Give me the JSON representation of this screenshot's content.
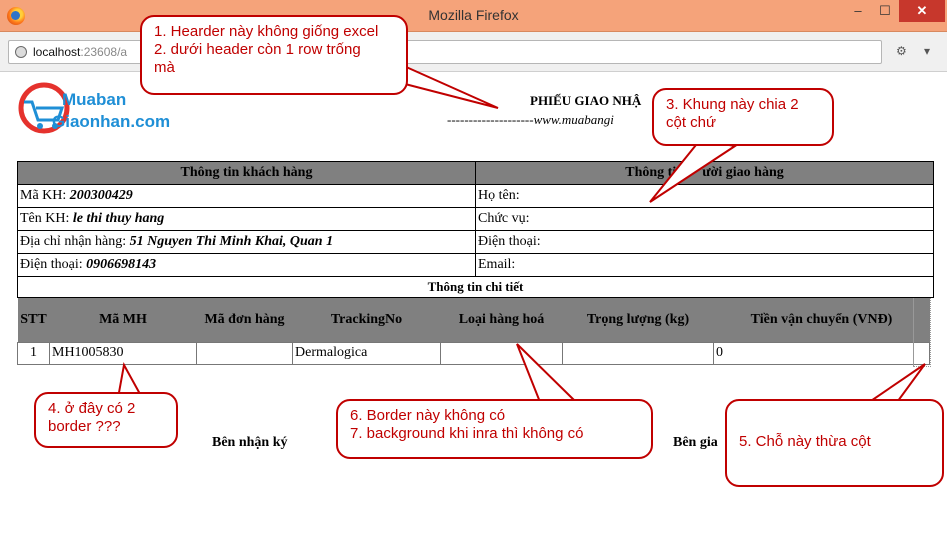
{
  "window": {
    "title": "Mozilla Firefox",
    "min_label": "–",
    "max_label": "☐",
    "close_label": "✕"
  },
  "addressbar": {
    "host": "localhost",
    "rest": ":23608/a"
  },
  "logo": {
    "line1": "Muaban",
    "line2": "Giaonhan",
    "dotcom": ".com"
  },
  "document": {
    "title": "PHIẾU GIAO NHẬ",
    "subtitle": "--------------------www.muabangi"
  },
  "customer_table": {
    "header_left": "Thông tin khách hàng",
    "header_right": "Thông ti",
    "header_right_tail": "ười giao hàng",
    "rows": [
      {
        "left_label": "Mã KH: ",
        "left_value": "200300429",
        "right_label": "Họ tên:"
      },
      {
        "left_label": "Tên KH: ",
        "left_value": "le thi thuy hang",
        "right_label": "Chức vụ:"
      },
      {
        "left_label": "Địa chỉ nhận hàng: ",
        "left_value": "51 Nguyen Thi Minh Khai, Quan 1",
        "right_label": "Điện thoại:"
      },
      {
        "left_label": "Điện thoại: ",
        "left_value": "0906698143",
        "right_label": "Email:"
      }
    ],
    "detail_caption": "Thông tin chi tiết"
  },
  "detail_table": {
    "headers": [
      "STT",
      "Mã MH",
      "Mã đơn hàng",
      "TrackingNo",
      "Loại hàng hoá",
      "Trọng lượng (kg)",
      "Tiền vận chuyển (VNĐ)"
    ],
    "rows": [
      [
        "1",
        "MH1005830",
        "",
        "Dermalogica",
        "",
        "",
        "0"
      ]
    ]
  },
  "signatures": {
    "left": "Bên nhận ký",
    "right": "Bên gia"
  },
  "callouts": {
    "c1_line1": "1. Hearder này không giống excel",
    "c1_line2": "2. dưới header còn 1 row trống",
    "c1_line3": "mà",
    "c3_line1": "3. Khung này chia 2",
    "c3_line2": "cột chứ",
    "c4_line1": "4. ở đây có 2",
    "c4_line2": "border ???",
    "c6_line1": "6. Border này không có",
    "c6_line2": "7. background khi inra thì không có",
    "c5_line1": "5. Chỗ này thừa cột"
  },
  "colors": {
    "titlebar": "#f5a37a",
    "table_header": "#808080",
    "callout": "#c00000",
    "logo_blue": "#1f8fd6",
    "logo_red": "#e5322d"
  }
}
